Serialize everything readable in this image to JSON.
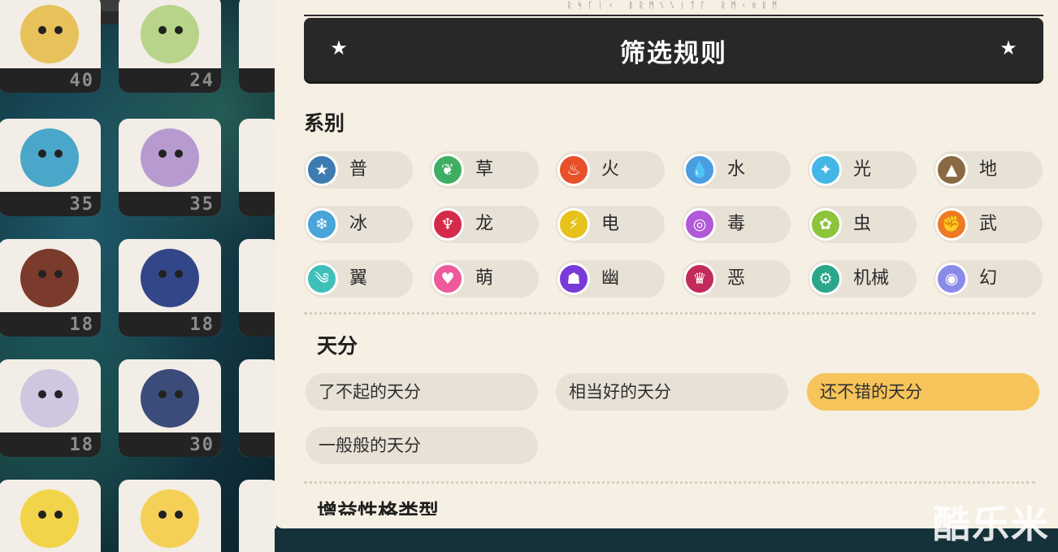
{
  "background_cards": [
    {
      "level": "40",
      "color": "#e7c25a"
    },
    {
      "level": "24",
      "color": "#b8d48a"
    },
    {
      "level": "35",
      "color": "#4aa7c9"
    },
    {
      "level": "35",
      "color": "#b69ad0"
    },
    {
      "level": "18",
      "color": "#7a3a2c"
    },
    {
      "level": "18",
      "color": "#33468a"
    },
    {
      "level": "18",
      "color": "#cfc6e0"
    },
    {
      "level": "30",
      "color": "#3c4c7a"
    },
    {
      "level": "",
      "color": "#f2d44a"
    },
    {
      "level": "",
      "color": "#f4d057"
    }
  ],
  "rune_line": "ᚱᛋᚴᛁᚲ ᛒᚱᛗᛊᛊᛁᛏᚴ ᚱᛗᚲᛟᚱᛗ",
  "header": {
    "title": "筛选规则"
  },
  "element_section": {
    "title": "系别",
    "types": [
      {
        "label": "普",
        "icon": "star-shield-icon",
        "color": "#3d7bb0",
        "glyph": "★"
      },
      {
        "label": "草",
        "icon": "leaf-icon",
        "color": "#3fae63",
        "glyph": "❦"
      },
      {
        "label": "火",
        "icon": "flame-icon",
        "color": "#e8502a",
        "glyph": "♨"
      },
      {
        "label": "水",
        "icon": "water-drop-icon",
        "color": "#4a9ee0",
        "glyph": "💧"
      },
      {
        "label": "光",
        "icon": "light-diamond-icon",
        "color": "#43b6e6",
        "glyph": "✦"
      },
      {
        "label": "地",
        "icon": "mountain-icon",
        "color": "#8a6a42",
        "glyph": "▲"
      },
      {
        "label": "冰",
        "icon": "snowflake-icon",
        "color": "#4aa4d8",
        "glyph": "❄"
      },
      {
        "label": "龙",
        "icon": "dragon-icon",
        "color": "#d62a4a",
        "glyph": "♆"
      },
      {
        "label": "电",
        "icon": "lightning-icon",
        "color": "#e6c21a",
        "glyph": "⚡"
      },
      {
        "label": "毒",
        "icon": "poison-bubble-icon",
        "color": "#b05ad8",
        "glyph": "◎"
      },
      {
        "label": "虫",
        "icon": "bug-icon",
        "color": "#8cc43a",
        "glyph": "✿"
      },
      {
        "label": "武",
        "icon": "fist-icon",
        "color": "#ee7a22",
        "glyph": "✊"
      },
      {
        "label": "翼",
        "icon": "wing-icon",
        "color": "#3ec0b8",
        "glyph": "༄"
      },
      {
        "label": "萌",
        "icon": "heart-icon",
        "color": "#ee5a9a",
        "glyph": "♥"
      },
      {
        "label": "幽",
        "icon": "ghost-icon",
        "color": "#7a3ad8",
        "glyph": "☗"
      },
      {
        "label": "恶",
        "icon": "devil-icon",
        "color": "#c22a5a",
        "glyph": "♛"
      },
      {
        "label": "机械",
        "icon": "gear-icon",
        "color": "#2aa68a",
        "glyph": "⚙"
      },
      {
        "label": "幻",
        "icon": "spiral-icon",
        "color": "#8a8ae8",
        "glyph": "◉"
      }
    ]
  },
  "talent_section": {
    "title": "天分",
    "options": [
      {
        "label": "了不起的天分",
        "selected": false
      },
      {
        "label": "相当好的天分",
        "selected": false
      },
      {
        "label": "还不错的天分",
        "selected": true
      },
      {
        "label": "一般般的天分",
        "selected": false
      }
    ]
  },
  "next_section": {
    "title": "增益性格类型"
  },
  "watermark": "酷乐米",
  "colors": {
    "panel_bg": "#f6efe3",
    "header_bg": "#282828",
    "chip_bg": "#e8e1d6",
    "selected": "#f6c45a"
  }
}
